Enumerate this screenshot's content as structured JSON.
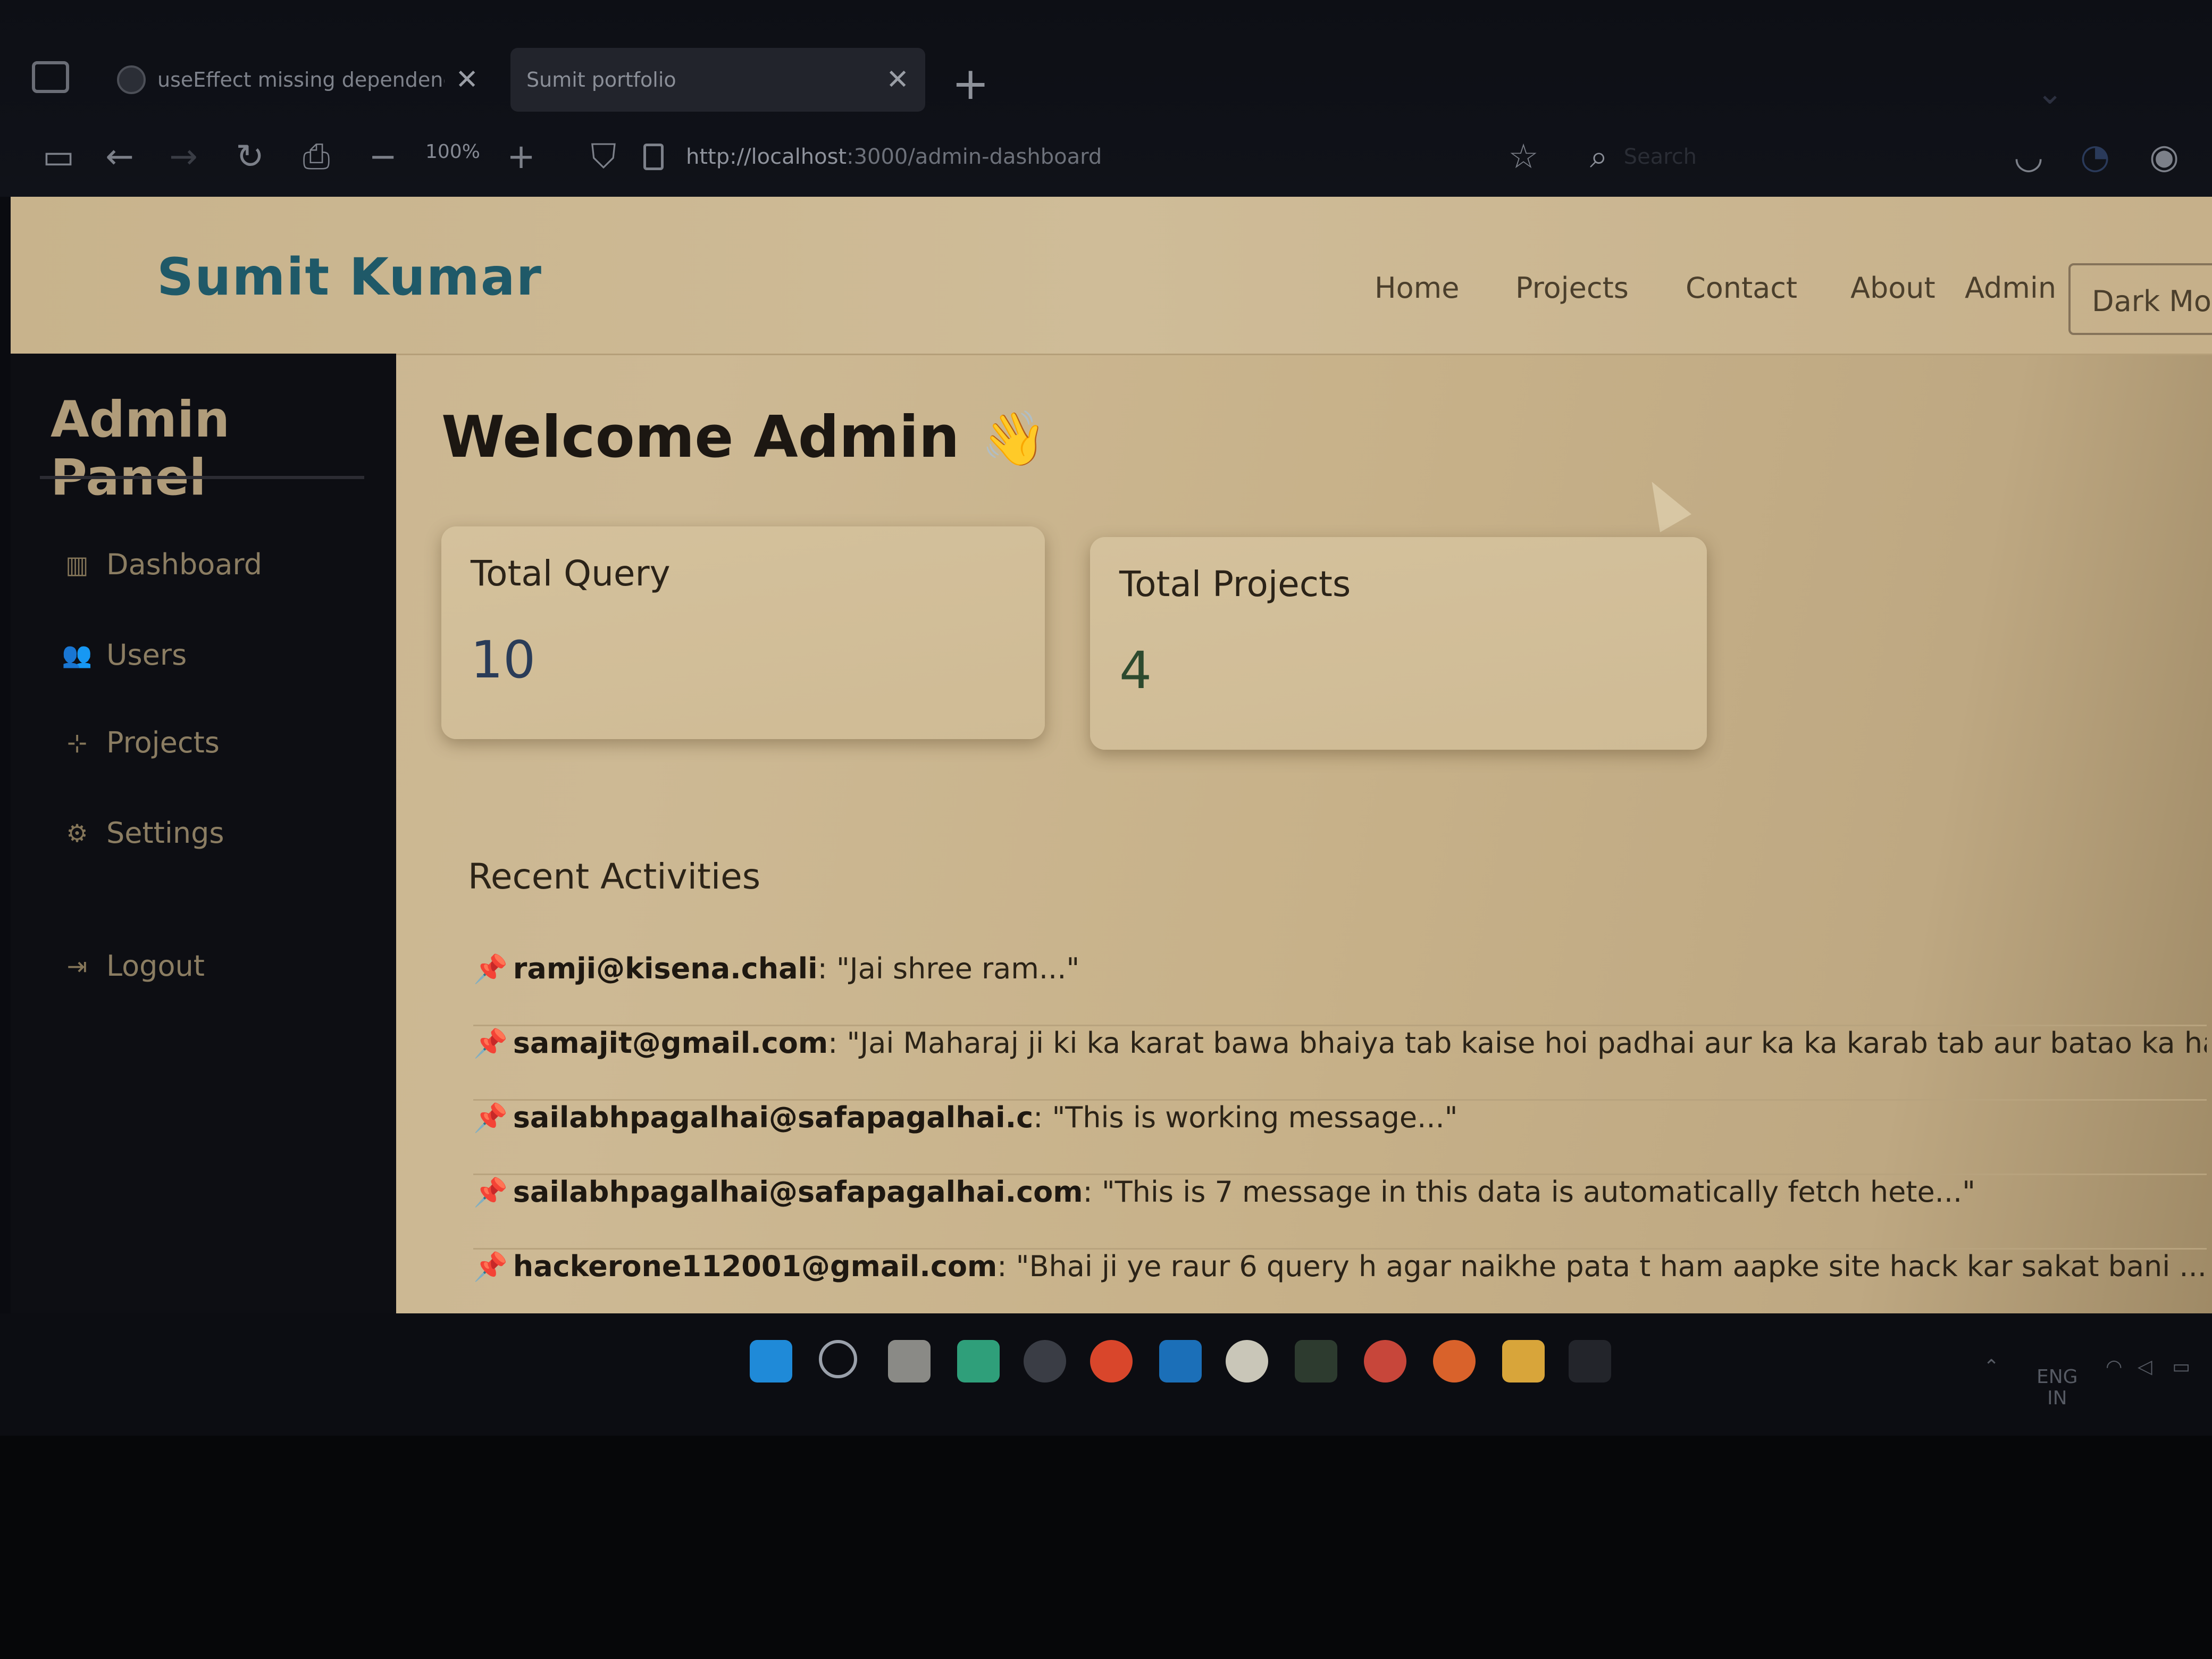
{
  "browser": {
    "tabs": [
      {
        "title": "useEffect missing dependency fix",
        "active": false
      },
      {
        "title": "Sumit portfolio",
        "active": true
      }
    ],
    "new_tab_label": "+",
    "zoom": "100%",
    "url_host": "http://localhost",
    "url_rest": ":3000/admin-dashboard",
    "search_placeholder": "Search"
  },
  "site": {
    "brand": "Sumit Kumar",
    "nav": [
      "Home",
      "Projects",
      "Contact",
      "About",
      "Admin"
    ],
    "dark_mode_button": "Dark Mode"
  },
  "sidebar": {
    "title": "Admin Panel",
    "items": [
      {
        "label": "Dashboard",
        "icon": "chart-bar-icon"
      },
      {
        "label": "Users",
        "icon": "users-icon"
      },
      {
        "label": "Projects",
        "icon": "project-diagram-icon"
      },
      {
        "label": "Settings",
        "icon": "cogs-icon"
      },
      {
        "label": "Logout",
        "icon": "sign-out-icon"
      }
    ]
  },
  "main": {
    "welcome": "Welcome Admin",
    "cards": [
      {
        "label": "Total Query",
        "value": "10"
      },
      {
        "label": "Total Projects",
        "value": "4"
      }
    ],
    "recent_title": "Recent Activities",
    "activities": [
      {
        "email": "ramji@kisena.chali",
        "message": ": \"Jai shree ram...\""
      },
      {
        "email": "samajit@gmail.com",
        "message": ": \"Jai Maharaj ji ki ka karat bawa bhaiya tab kaise hoi padhai aur ka ka karab tab aur batao ka hal ba ...\""
      },
      {
        "email": "sailabhpagalhai@safapagalhai.c",
        "message": ": \"This is working message...\""
      },
      {
        "email": "sailabhpagalhai@safapagalhai.com",
        "message": ": \"This is 7 message in this data is automatically fetch hete...\""
      },
      {
        "email": "hackerone112001@gmail.com",
        "message": ": \"Bhai ji ye raur 6 query h agar naikhe pata t ham aapke site hack kar sakat bani ...\""
      }
    ]
  },
  "taskbar": {
    "lang_line1": "ENG",
    "lang_line2": "IN"
  },
  "colors": {
    "brand": "#1f5968",
    "sidebar_bg": "#0d0e13",
    "page_bg": "#c9b48e",
    "pin": "#b3362c"
  }
}
